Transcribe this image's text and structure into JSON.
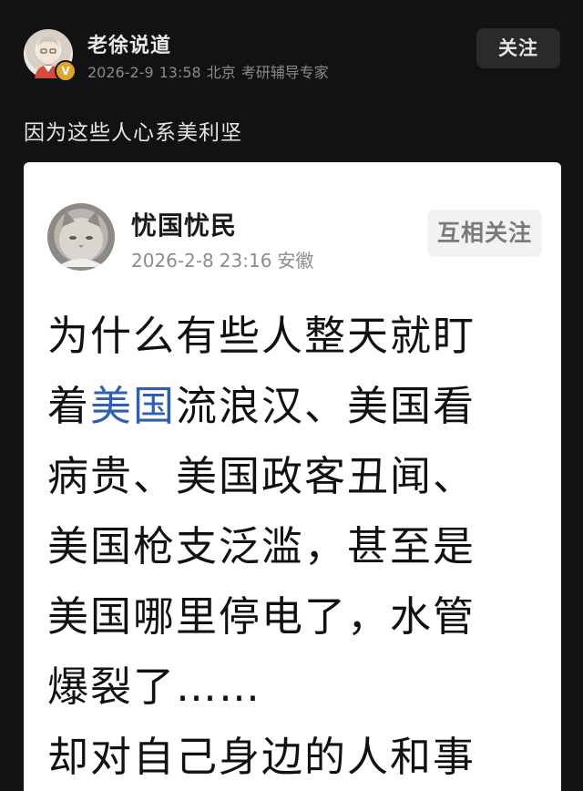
{
  "header": {
    "author_name": "老徐说道",
    "badge": "V",
    "date": "2026-2-9",
    "time": "13:58",
    "location": "北京",
    "role": "考研辅导专家",
    "follow_label": "关注"
  },
  "post": {
    "text": "因为这些人心系美利坚"
  },
  "quoted": {
    "author_name": "忧国忧民",
    "date": "2026-2-8",
    "time": "23:16",
    "location": "安徽",
    "mutual_label": "互相关注",
    "lines": {
      "l1": "为什么有些人整天就盯",
      "l2_pre": "着",
      "l2_link": "美国",
      "l2_post": "流浪汉、美国看",
      "l3": "病贵、美国政客丑闻、",
      "l4": "美国枪支泛滥，甚至是",
      "l5": "美国哪里停电了，水管",
      "l6": "爆裂了……",
      "l7": "却对自己身边的人和事"
    },
    "link_color": "#2f5fb3"
  }
}
